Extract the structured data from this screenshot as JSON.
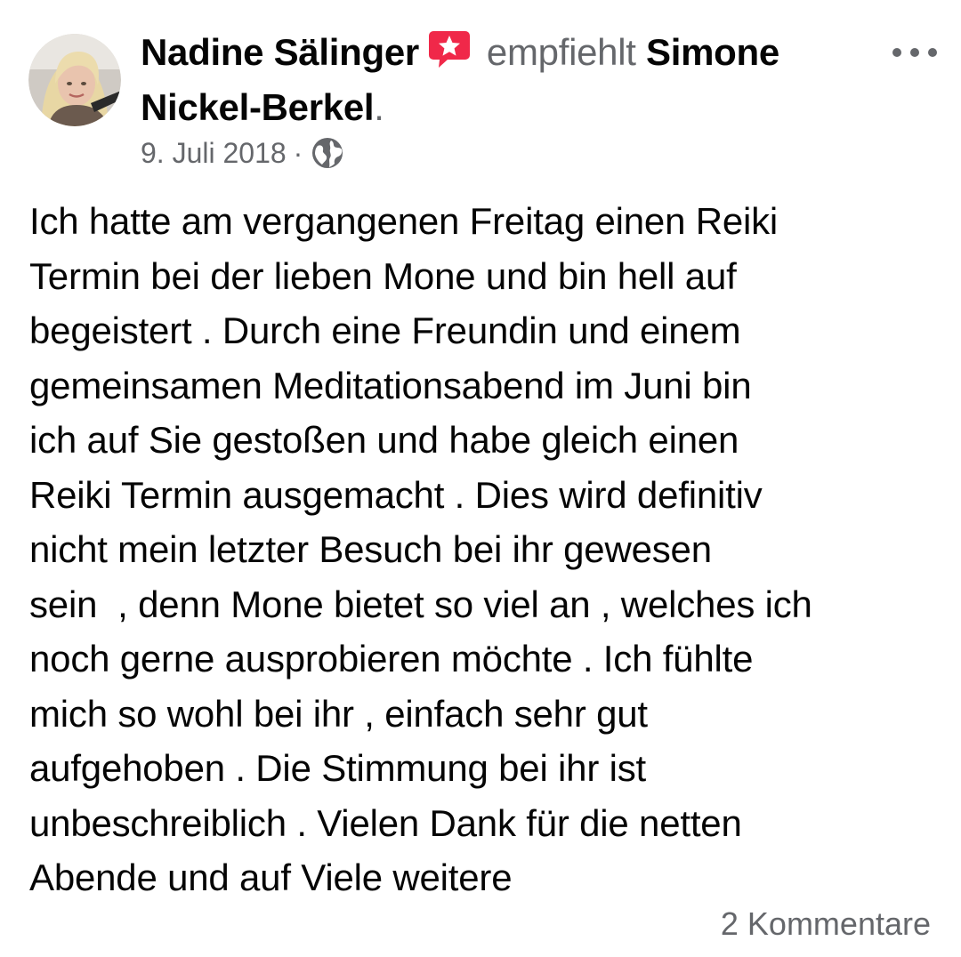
{
  "post": {
    "author": "Nadine Sälinger",
    "action": "empfiehlt",
    "target": "Simone Nickel-Berkel",
    "trailing_punct": ".",
    "date": "9. Juli 2018",
    "separator": "·",
    "privacy_icon": "globe-icon",
    "recommend_icon": "recommendation-badge-icon",
    "more_icon": "more-options-icon",
    "body_lines": [
      "Ich hatte am vergangenen Freitag einen Reiki",
      "Termin bei der lieben Mone und bin hell auf",
      "begeistert . Durch eine Freundin und einem",
      "gemeinsamen Meditationsabend im Juni bin",
      "ich auf Sie gestoßen und habe gleich einen",
      "Reiki Termin ausgemacht . Dies wird definitiv",
      "nicht mein letzter Besuch bei ihr gewesen",
      "sein  , denn Mone bietet so viel an , welches ich",
      "noch gerne ausprobieren möchte . Ich fühlte",
      "mich so wohl bei ihr , einfach sehr gut",
      "aufgehoben . Die Stimmung bei ihr ist",
      "unbeschreiblich . Vielen Dank für die netten",
      "Abende und auf Viele weitere"
    ],
    "comments_label": "2 Kommentare"
  },
  "colors": {
    "primary_text": "#050505",
    "secondary_text": "#65676b",
    "recommend_badge": "#f02849"
  }
}
